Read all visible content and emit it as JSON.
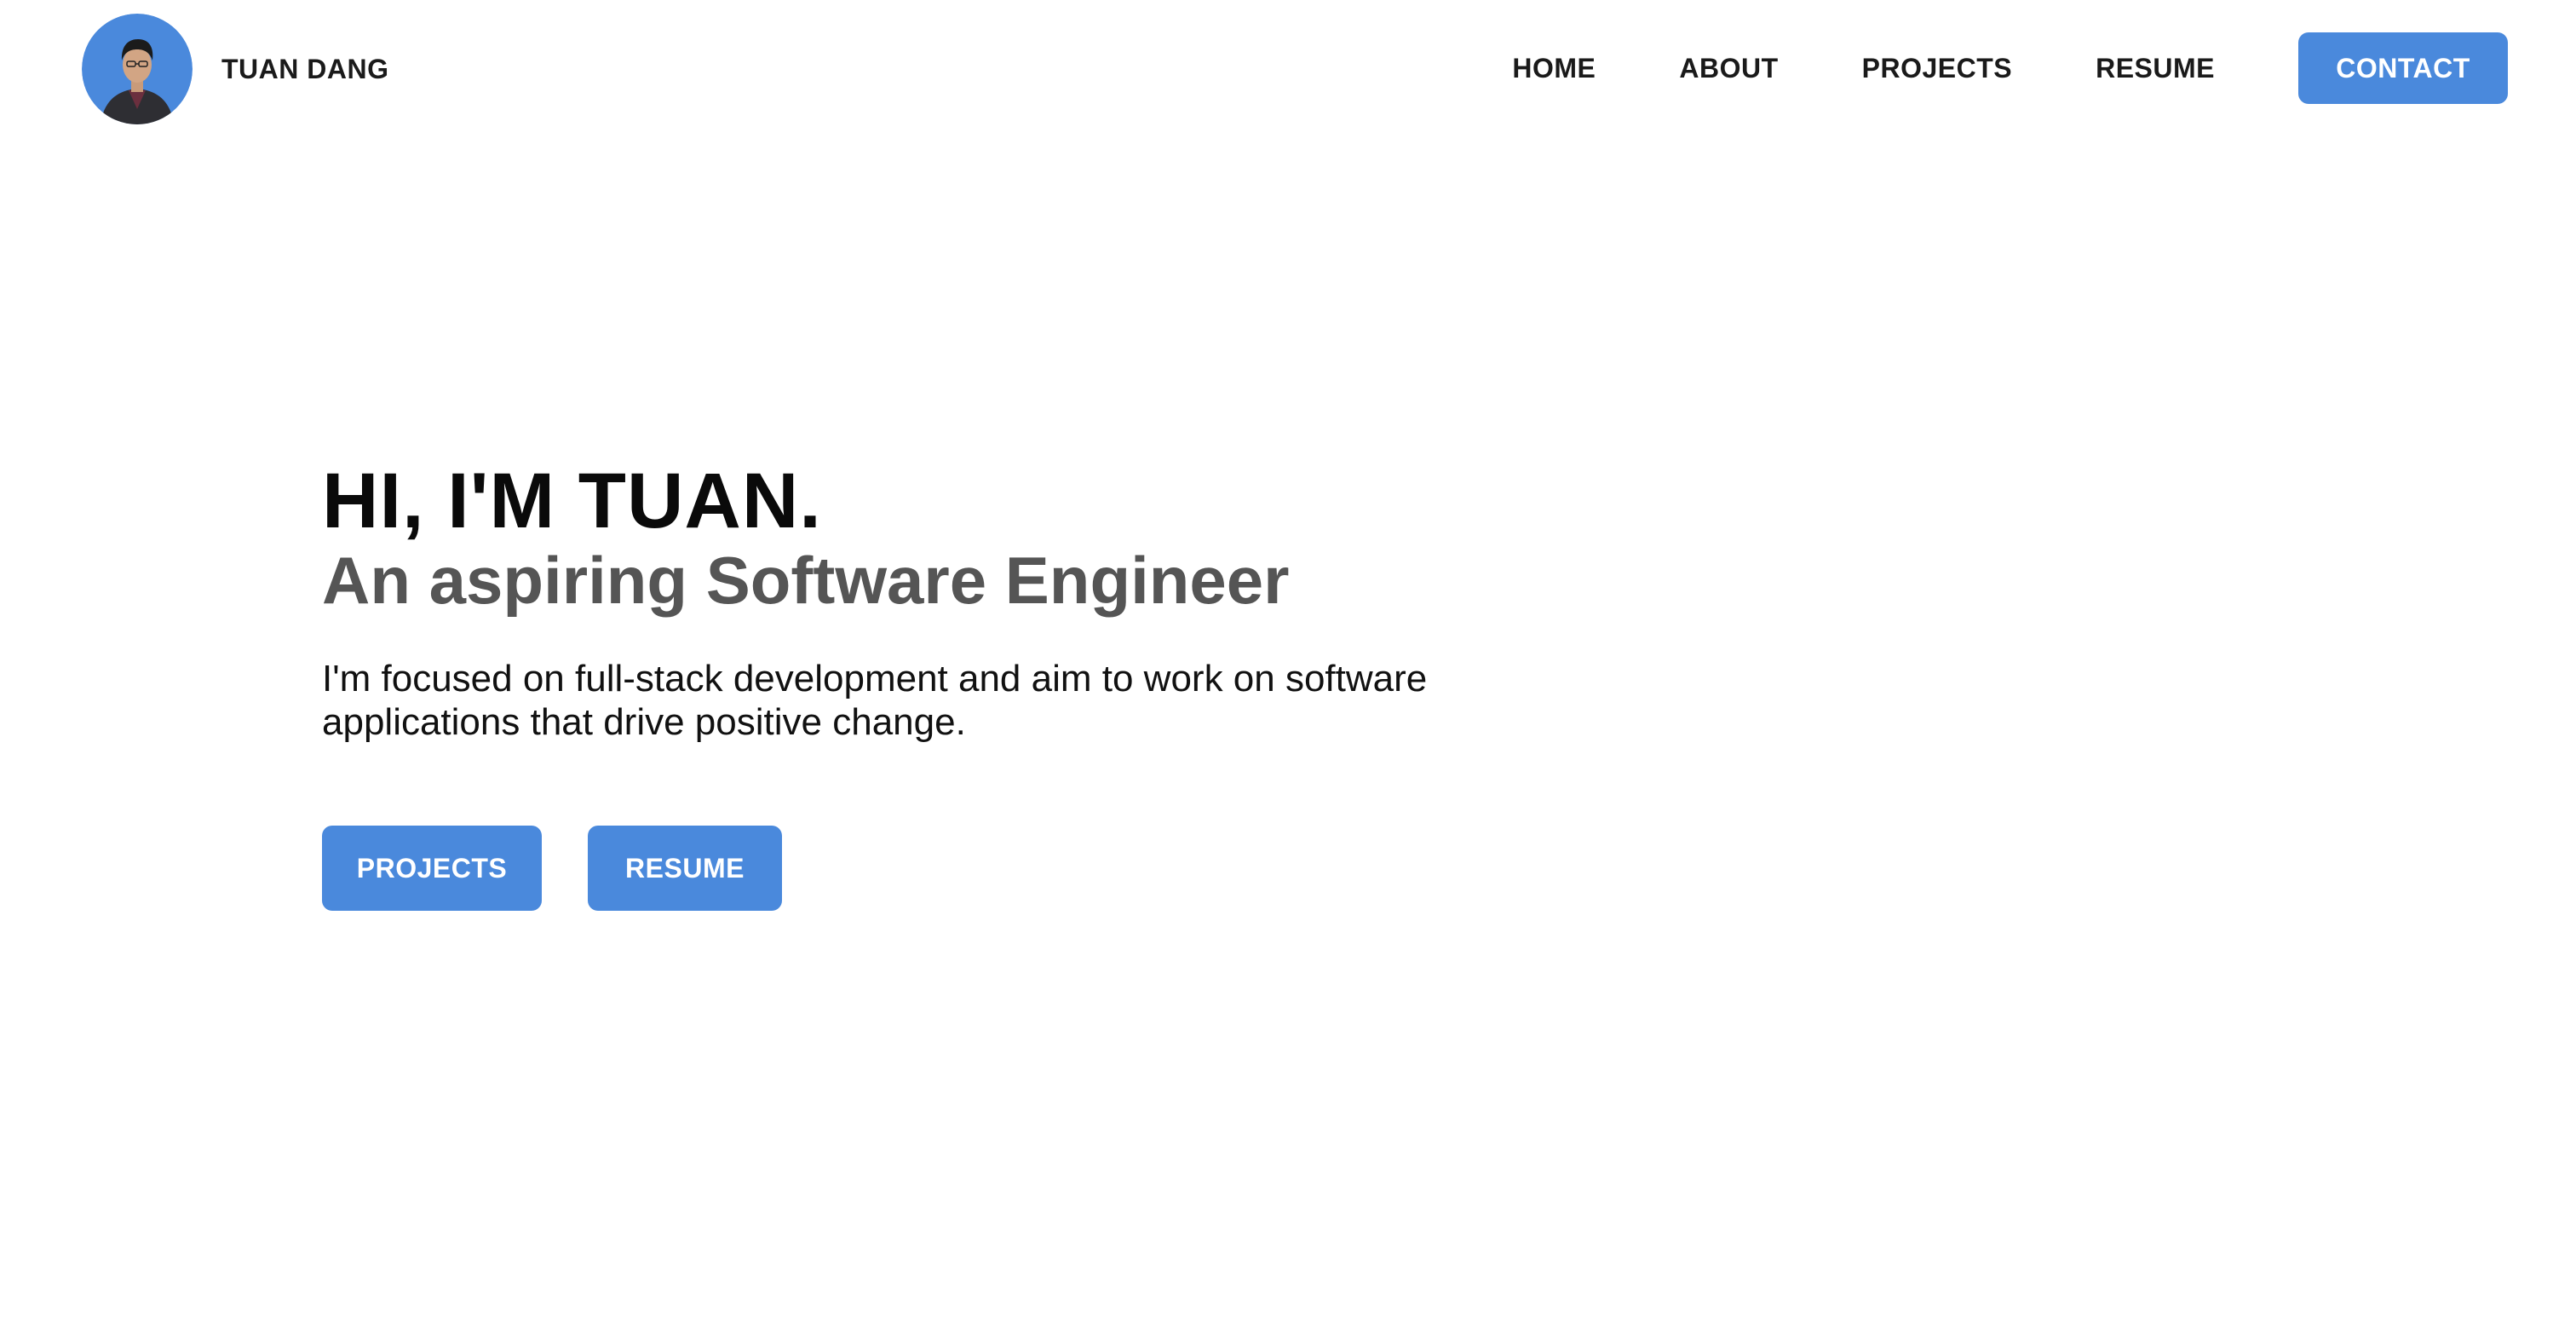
{
  "brand": {
    "name": "TUAN DANG",
    "avatar_icon": "profile-photo-avatar"
  },
  "nav": {
    "home": "HOME",
    "about": "ABOUT",
    "projects": "PROJECTS",
    "resume": "RESUME",
    "contact": "CONTACT"
  },
  "hero": {
    "title": "HI, I'M TUAN.",
    "subtitle": "An aspiring Software Engineer",
    "description": "I'm focused on full-stack development and aim to work on software applications that drive positive change.",
    "buttons": {
      "projects": "PROJECTS",
      "resume": "RESUME"
    }
  },
  "colors": {
    "accent": "#4a89dc",
    "heading": "#0a0a0a",
    "subheading": "#555555",
    "text": "#111111"
  }
}
